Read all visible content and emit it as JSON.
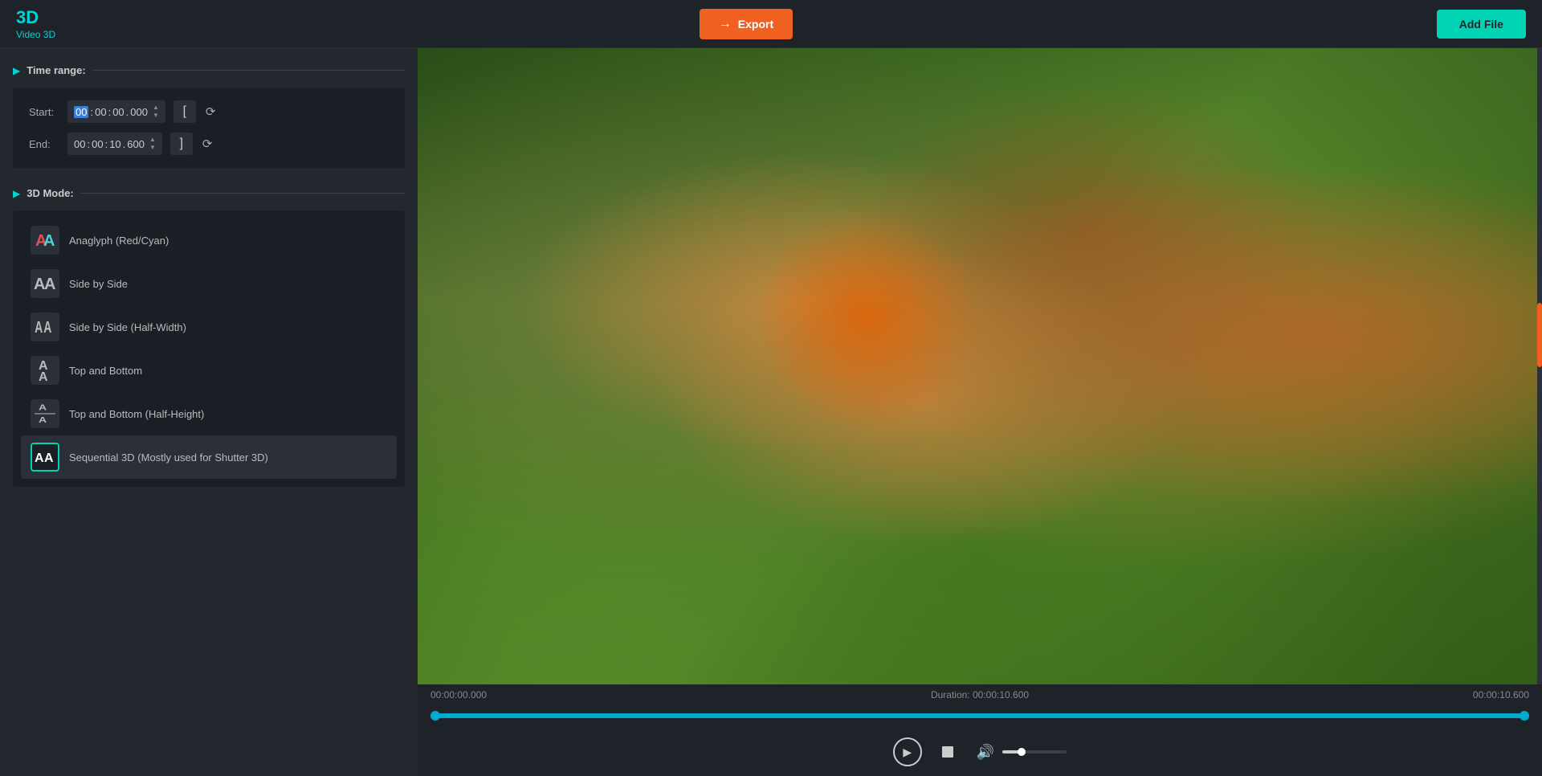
{
  "app": {
    "logo": "3D",
    "subtitle": "Video 3D"
  },
  "topbar": {
    "export_label": "Export",
    "add_file_label": "Add File"
  },
  "left_panel": {
    "time_range_title": "Time range:",
    "mode_title": "3D Mode:",
    "start_label": "Start:",
    "end_label": "End:",
    "start_time": {
      "h": "00",
      "m": "00",
      "s": "00",
      "ms": "000"
    },
    "end_time": {
      "h": "00",
      "m": "00",
      "s": "10",
      "ms": "600"
    },
    "modes": [
      {
        "id": "anaglyph",
        "label": "Anaglyph (Red/Cyan)",
        "active": false
      },
      {
        "id": "side-by-side",
        "label": "Side by Side",
        "active": false
      },
      {
        "id": "side-by-side-half",
        "label": "Side by Side (Half-Width)",
        "active": false
      },
      {
        "id": "top-bottom",
        "label": "Top and Bottom",
        "active": false
      },
      {
        "id": "top-bottom-half",
        "label": "Top and Bottom (Half-Height)",
        "active": false
      },
      {
        "id": "sequential-3d",
        "label": "Sequential 3D (Mostly used for Shutter 3D)",
        "active": true
      }
    ]
  },
  "video": {
    "start_time": "00:00:00.000",
    "duration_label": "Duration:",
    "duration": "00:00:10.600",
    "end_time": "00:00:10.600"
  },
  "controls": {
    "play_title": "Play",
    "stop_title": "Stop",
    "volume_title": "Volume"
  }
}
